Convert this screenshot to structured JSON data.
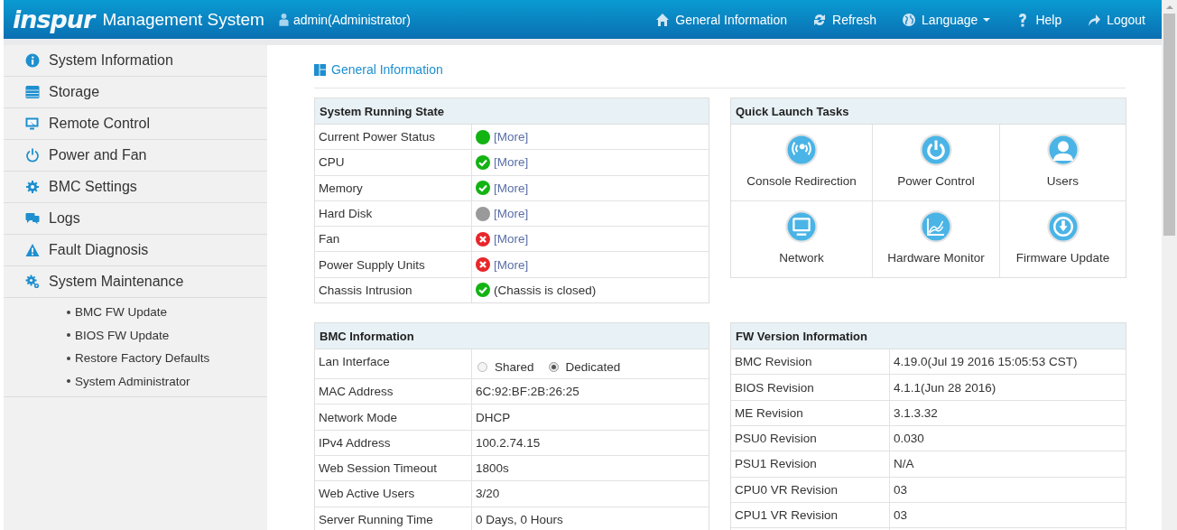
{
  "header": {
    "logo": "inspur",
    "title": "Management System",
    "user": "admin(Administrator)",
    "nav": [
      {
        "label": "General Information"
      },
      {
        "label": "Refresh"
      },
      {
        "label": "Language",
        "dropdown": true
      },
      {
        "label": "Help"
      },
      {
        "label": "Logout"
      }
    ]
  },
  "sidebar": {
    "items": [
      {
        "label": "System Information"
      },
      {
        "label": "Storage"
      },
      {
        "label": "Remote Control"
      },
      {
        "label": "Power and Fan"
      },
      {
        "label": "BMC Settings"
      },
      {
        "label": "Logs"
      },
      {
        "label": "Fault Diagnosis"
      },
      {
        "label": "System Maintenance",
        "children": [
          {
            "label": "BMC FW Update"
          },
          {
            "label": "BIOS FW Update"
          },
          {
            "label": "Restore Factory Defaults"
          },
          {
            "label": "System Administrator"
          }
        ]
      }
    ]
  },
  "breadcrumb": "General Information",
  "running_state": {
    "title": "System Running State",
    "rows": [
      {
        "label": "Current Power Status",
        "kind": "on",
        "text": "[More]",
        "link": true
      },
      {
        "label": "CPU",
        "kind": "ok",
        "text": "[More]",
        "link": true
      },
      {
        "label": "Memory",
        "kind": "ok",
        "text": "[More]",
        "link": true
      },
      {
        "label": "Hard Disk",
        "kind": "unknown",
        "text": "[More]",
        "link": true
      },
      {
        "label": "Fan",
        "kind": "fail",
        "text": "[More]",
        "link": true
      },
      {
        "label": "Power Supply Units",
        "kind": "fail",
        "text": "[More]",
        "link": true
      },
      {
        "label": "Chassis Intrusion",
        "kind": "ok",
        "text": "(Chassis is closed)",
        "link": false
      }
    ]
  },
  "quick_launch": {
    "title": "Quick Launch Tasks",
    "tasks": [
      {
        "label": "Console Redirection"
      },
      {
        "label": "Power Control"
      },
      {
        "label": "Users"
      },
      {
        "label": "Network"
      },
      {
        "label": "Hardware Monitor"
      },
      {
        "label": "Firmware Update"
      }
    ]
  },
  "bmc_info": {
    "title": "BMC Information",
    "lan_interface": {
      "label": "Lan Interface",
      "options": [
        {
          "label": "Shared",
          "selected": false
        },
        {
          "label": "Dedicated",
          "selected": true
        }
      ]
    },
    "rows": [
      {
        "label": "MAC Address",
        "value": "6C:92:BF:2B:26:25"
      },
      {
        "label": "Network Mode",
        "value": "DHCP"
      },
      {
        "label": "IPv4 Address",
        "value": "100.2.74.15"
      },
      {
        "label": "Web Session Timeout",
        "value": "1800s"
      },
      {
        "label": "Web Active Users",
        "value": "3/20"
      },
      {
        "label": "Server Running Time",
        "value": "0 Days, 0 Hours"
      }
    ]
  },
  "fw_info": {
    "title": "FW Version Information",
    "rows": [
      {
        "label": "BMC Revision",
        "value": "4.19.0(Jul 19 2016 15:05:53 CST)"
      },
      {
        "label": "BIOS Revision",
        "value": "4.1.1(Jun 28 2016)"
      },
      {
        "label": "ME Revision",
        "value": "3.1.3.32"
      },
      {
        "label": "PSU0 Revision",
        "value": "0.030"
      },
      {
        "label": "PSU1 Revision",
        "value": "N/A"
      },
      {
        "label": "CPU0 VR Revision",
        "value": "03"
      },
      {
        "label": "CPU1 VR Revision",
        "value": "03"
      }
    ]
  }
}
